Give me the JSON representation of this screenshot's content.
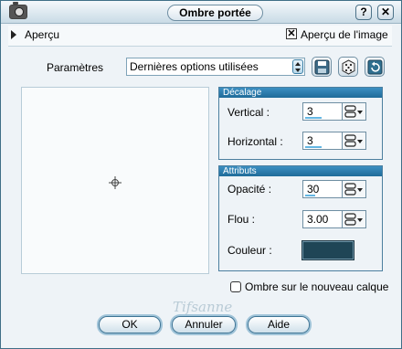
{
  "window": {
    "title": "Ombre portée"
  },
  "title_buttons": {
    "help": "?",
    "close": "✕"
  },
  "preview": {
    "label": "Aperçu",
    "image_preview_label": "Aperçu de l'image",
    "image_preview_checked": "✕"
  },
  "params": {
    "label": "Paramètres",
    "preset": "Dernières options utilisées"
  },
  "offset": {
    "header": "Décalage",
    "vertical_label": "Vertical :",
    "vertical_value": "3",
    "vertical_fill": 0.5,
    "horizontal_label": "Horizontal :",
    "horizontal_value": "3",
    "horizontal_fill": 0.5
  },
  "attributes": {
    "header": "Attributs",
    "opacity_label": "Opacité :",
    "opacity_value": "30",
    "opacity_fill": 0.3,
    "blur_label": "Flou :",
    "blur_value": "3.00",
    "color_label": "Couleur :",
    "color_value": "#1f4556"
  },
  "shadow_new_layer": {
    "label": "Ombre sur le nouveau calque",
    "checked": false
  },
  "buttons": {
    "ok": "OK",
    "cancel": "Annuler",
    "help": "Aide"
  },
  "watermark": "Tifsanne",
  "colors": {
    "accent": "#2a78a8",
    "frame": "#3f6f87"
  }
}
